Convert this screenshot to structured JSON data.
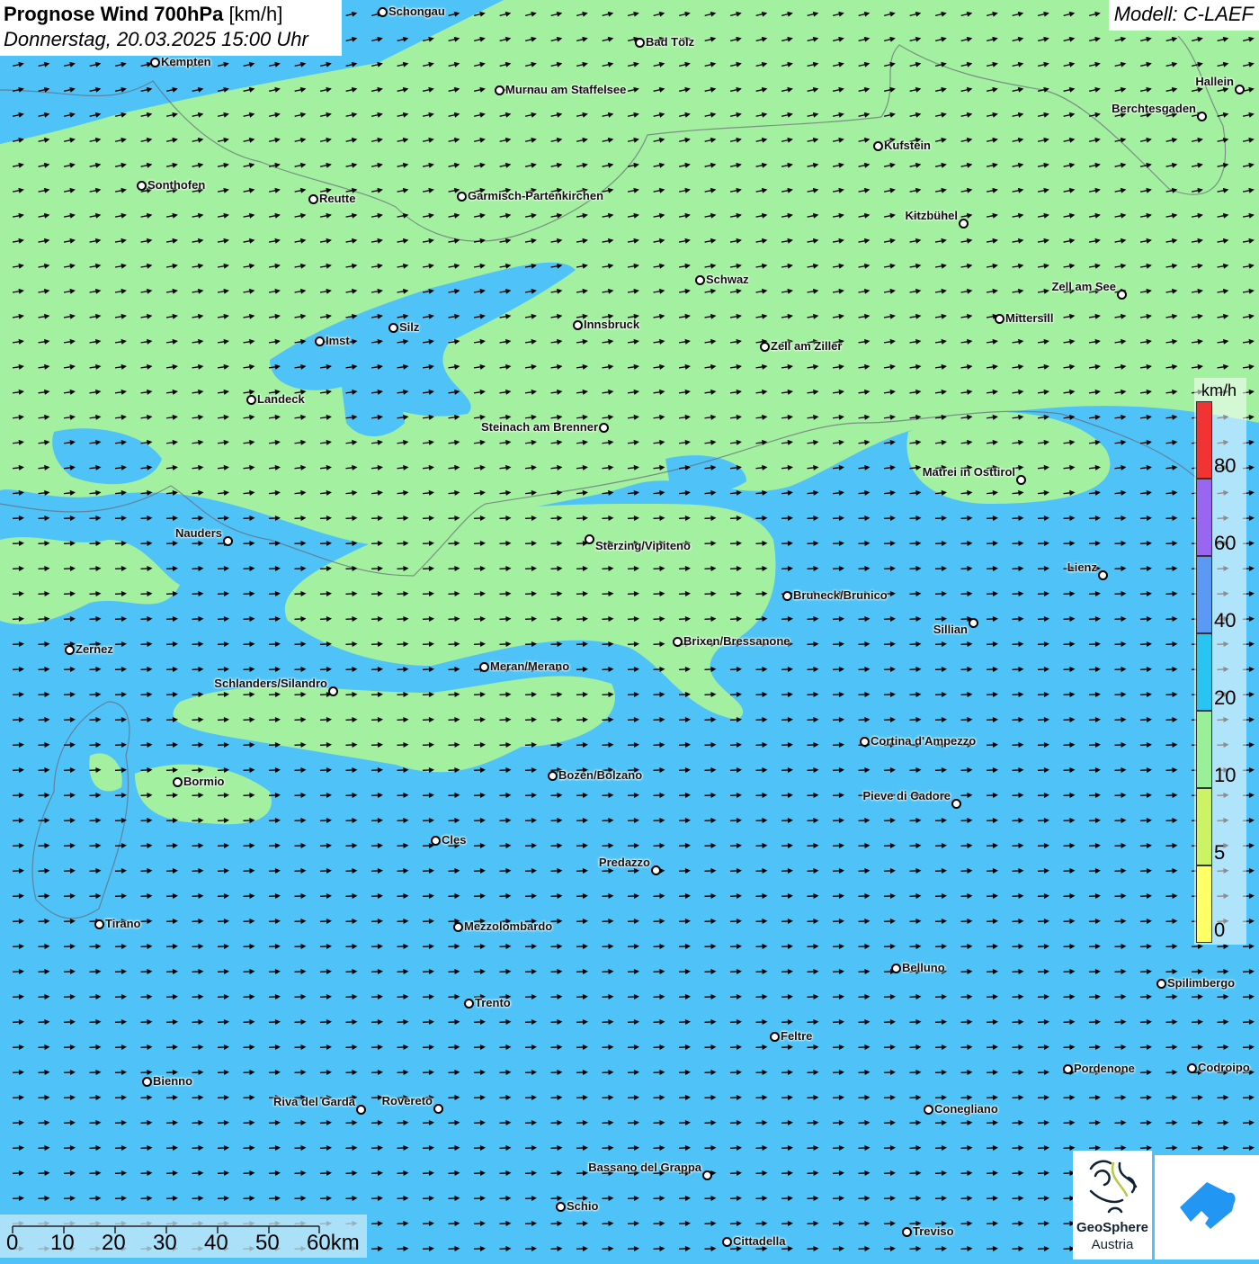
{
  "header": {
    "title_bold": "Prognose Wind 700hPa",
    "title_unit": "[km/h]",
    "subtitle": "Donnerstag, 20.03.2025 15:00 Uhr",
    "model": "Modell: C-LAEF"
  },
  "colors": {
    "calm_blue": "#4fc3f7",
    "light_green": "#a3f0a0",
    "arrow": "#000000"
  },
  "wind_direction": "from west-southwest (arrows pointing east / east-northeast)",
  "cities": [
    "Schongau",
    "Bad Tölz",
    "Kempten",
    "Murnau am Staffelsee",
    "Hallein",
    "Berchtesgaden",
    "Kufstein",
    "Sonthofen",
    "Reutte",
    "Garmisch-Partenkirchen",
    "Kitzbühel",
    "Schwaz",
    "Zell am See",
    "Mittersill",
    "Innsbruck",
    "Silz",
    "Imst",
    "Zell am Ziller",
    "Landeck",
    "Steinach am Brenner",
    "Matrei in Osttirol",
    "Nauders",
    "Sterzing/Vipiteno",
    "Lienz",
    "Bruneck/Brunico",
    "Sillian",
    "Zernez",
    "Brixen/Bressanone",
    "Meran/Merano",
    "Schlanders/Silandro",
    "Cortina d'Ampezzo",
    "Bozen/Bolzano",
    "Bormio",
    "Pieve di Cadore",
    "Cles",
    "Predazzo",
    "Tirano",
    "Mezzolombardo",
    "Belluno",
    "Spilimbergo",
    "Trento",
    "Feltre",
    "Pordenone",
    "Codroipo",
    "Bienno",
    "Riva del Garda",
    "Rovereto",
    "Conegliano",
    "Bassano del Grappa",
    "Schio",
    "Treviso",
    "Cittadella"
  ],
  "legend": {
    "unit": "km/h",
    "bands": [
      {
        "from": 0,
        "to": 5,
        "color": "#ffff66"
      },
      {
        "from": 5,
        "to": 10,
        "color": "#ccf266"
      },
      {
        "from": 10,
        "to": 20,
        "color": "#99f099"
      },
      {
        "from": 20,
        "to": 40,
        "color": "#29c4f2"
      },
      {
        "from": 40,
        "to": 60,
        "color": "#5c99f5"
      },
      {
        "from": 60,
        "to": 80,
        "color": "#9966f2"
      },
      {
        "from": 80,
        "to": null,
        "color": "#f23333"
      }
    ],
    "ticks": [
      "0",
      "5",
      "10",
      "20",
      "40",
      "60",
      "80"
    ]
  },
  "scale_bar": {
    "labels": [
      "0",
      "10",
      "20",
      "30",
      "40",
      "50",
      "60km"
    ]
  },
  "logos": {
    "geosphere_line1": "GeoSphere",
    "geosphere_line2": "Austria"
  }
}
